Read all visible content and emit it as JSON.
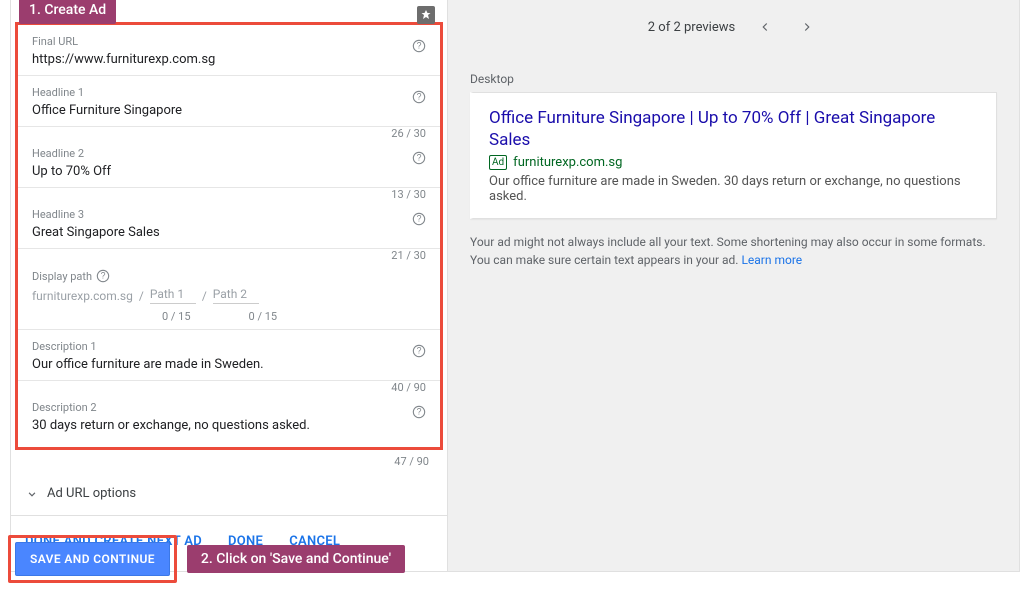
{
  "callouts": {
    "step1": "1. Create Ad",
    "step2": "2. Click on 'Save and Continue'"
  },
  "form": {
    "final_url": {
      "label": "Final URL",
      "value": "https://www.furniturexp.com.sg"
    },
    "headline1": {
      "label": "Headline 1",
      "value": "Office Furniture Singapore",
      "counter": "26 / 30"
    },
    "headline2": {
      "label": "Headline 2",
      "value": "Up to 70% Off",
      "counter": "13 / 30"
    },
    "headline3": {
      "label": "Headline 3",
      "value": "Great Singapore Sales",
      "counter": "21 / 30"
    },
    "display_path": {
      "label": "Display path",
      "domain": "furniturexp.com.sg",
      "path1_placeholder": "Path 1",
      "path2_placeholder": "Path 2",
      "path1_counter": "0 / 15",
      "path2_counter": "0 / 15"
    },
    "description1": {
      "label": "Description 1",
      "value": "Our office furniture are made in Sweden.",
      "counter": "40 / 90"
    },
    "description2": {
      "label": "Description 2",
      "value": "30 days return or exchange, no questions asked.",
      "counter": "47 / 90"
    },
    "ad_url_options": "Ad URL options"
  },
  "actions": {
    "done_next": "DONE AND CREATE NEXT AD",
    "done": "DONE",
    "cancel": "CANCEL",
    "save_continue": "SAVE AND CONTINUE"
  },
  "preview": {
    "header": "2 of 2 previews",
    "device": "Desktop",
    "ad_title": "Office Furniture Singapore | Up to 70% Off | Great Singapore Sales",
    "ad_badge": "Ad",
    "ad_url": "furniturexp.com.sg",
    "ad_desc": "Our office furniture are made in Sweden. 30 days return or exchange, no questions asked.",
    "note_text": "Your ad might not always include all your text. Some shortening may also occur in some formats. You can make sure certain text appears in your ad. ",
    "learn_more": "Learn more"
  }
}
